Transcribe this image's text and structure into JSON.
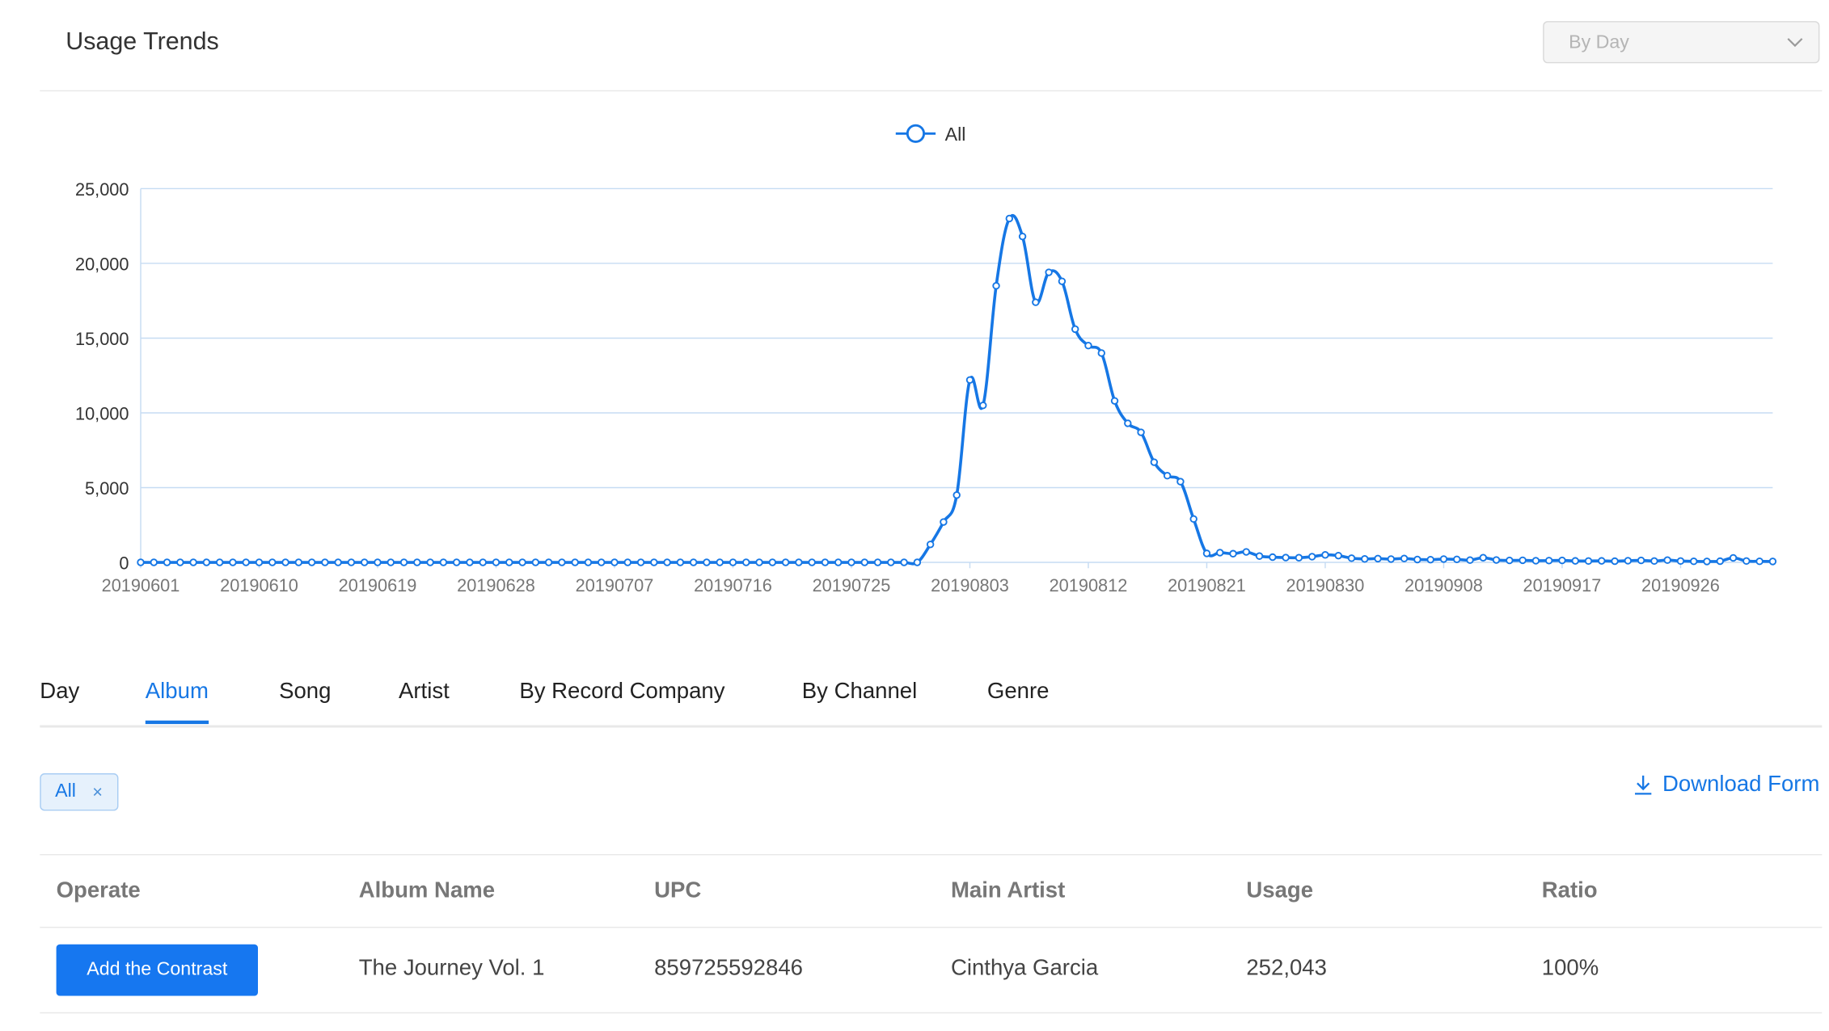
{
  "header": {
    "title": "Usage Trends",
    "period_select": {
      "value": "By Day"
    }
  },
  "chart_data": {
    "type": "line",
    "legend": [
      "All"
    ],
    "legend_position": "top-center",
    "grid": true,
    "ylim": [
      0,
      25000
    ],
    "y_ticks": [
      "0",
      "5,000",
      "10,000",
      "15,000",
      "20,000",
      "25,000"
    ],
    "x_tick_labels": [
      "20190601",
      "20190610",
      "20190619",
      "20190628",
      "20190707",
      "20190716",
      "20190725",
      "20190803",
      "20190812",
      "20190821",
      "20190830",
      "20190908",
      "20190917",
      "20190926"
    ],
    "x_start": "20190601",
    "series": [
      {
        "name": "All",
        "color": "#1677e5",
        "values": [
          0,
          0,
          0,
          0,
          0,
          0,
          0,
          0,
          0,
          0,
          0,
          0,
          0,
          0,
          0,
          0,
          0,
          0,
          0,
          0,
          0,
          0,
          0,
          0,
          0,
          0,
          0,
          0,
          0,
          0,
          0,
          0,
          0,
          0,
          0,
          0,
          0,
          0,
          0,
          0,
          0,
          0,
          0,
          0,
          0,
          0,
          0,
          0,
          0,
          0,
          0,
          0,
          0,
          0,
          0,
          0,
          0,
          0,
          0,
          0,
          1200,
          2700,
          4500,
          12200,
          10500,
          18500,
          23000,
          21800,
          17400,
          19400,
          18800,
          15600,
          14500,
          14000,
          10800,
          9300,
          8700,
          6700,
          5800,
          5400,
          2900,
          600,
          650,
          580,
          700,
          420,
          350,
          320,
          310,
          380,
          500,
          450,
          280,
          230,
          250,
          220,
          260,
          190,
          180,
          220,
          200,
          150,
          310,
          160,
          130,
          140,
          110,
          120,
          130,
          100,
          90,
          100,
          80,
          110,
          130,
          90,
          150,
          90,
          70,
          60,
          80,
          300,
          90,
          70,
          60
        ]
      }
    ]
  },
  "tabs": [
    {
      "label": "Day",
      "active": false
    },
    {
      "label": "Album",
      "active": true
    },
    {
      "label": "Song",
      "active": false
    },
    {
      "label": "Artist",
      "active": false
    },
    {
      "label": "By Record Company",
      "active": false
    },
    {
      "label": "By Channel",
      "active": false
    },
    {
      "label": "Genre",
      "active": false
    }
  ],
  "filter": {
    "tag_label": "All",
    "close_glyph": "×"
  },
  "download": {
    "label": "Download Form",
    "icon": "download-icon"
  },
  "table": {
    "columns": [
      "Operate",
      "Album Name",
      "UPC",
      "Main Artist",
      "Usage",
      "Ratio"
    ],
    "rows": [
      {
        "operate_label": "Add the Contrast",
        "album_name": "The Journey Vol. 1",
        "upc": "859725592846",
        "main_artist": "Cinthya Garcia",
        "usage": "252,043",
        "ratio": "100%"
      }
    ]
  },
  "colors": {
    "accent": "#1677e5",
    "grid": "#c6dcf3",
    "axis": "#c6dcf3"
  }
}
